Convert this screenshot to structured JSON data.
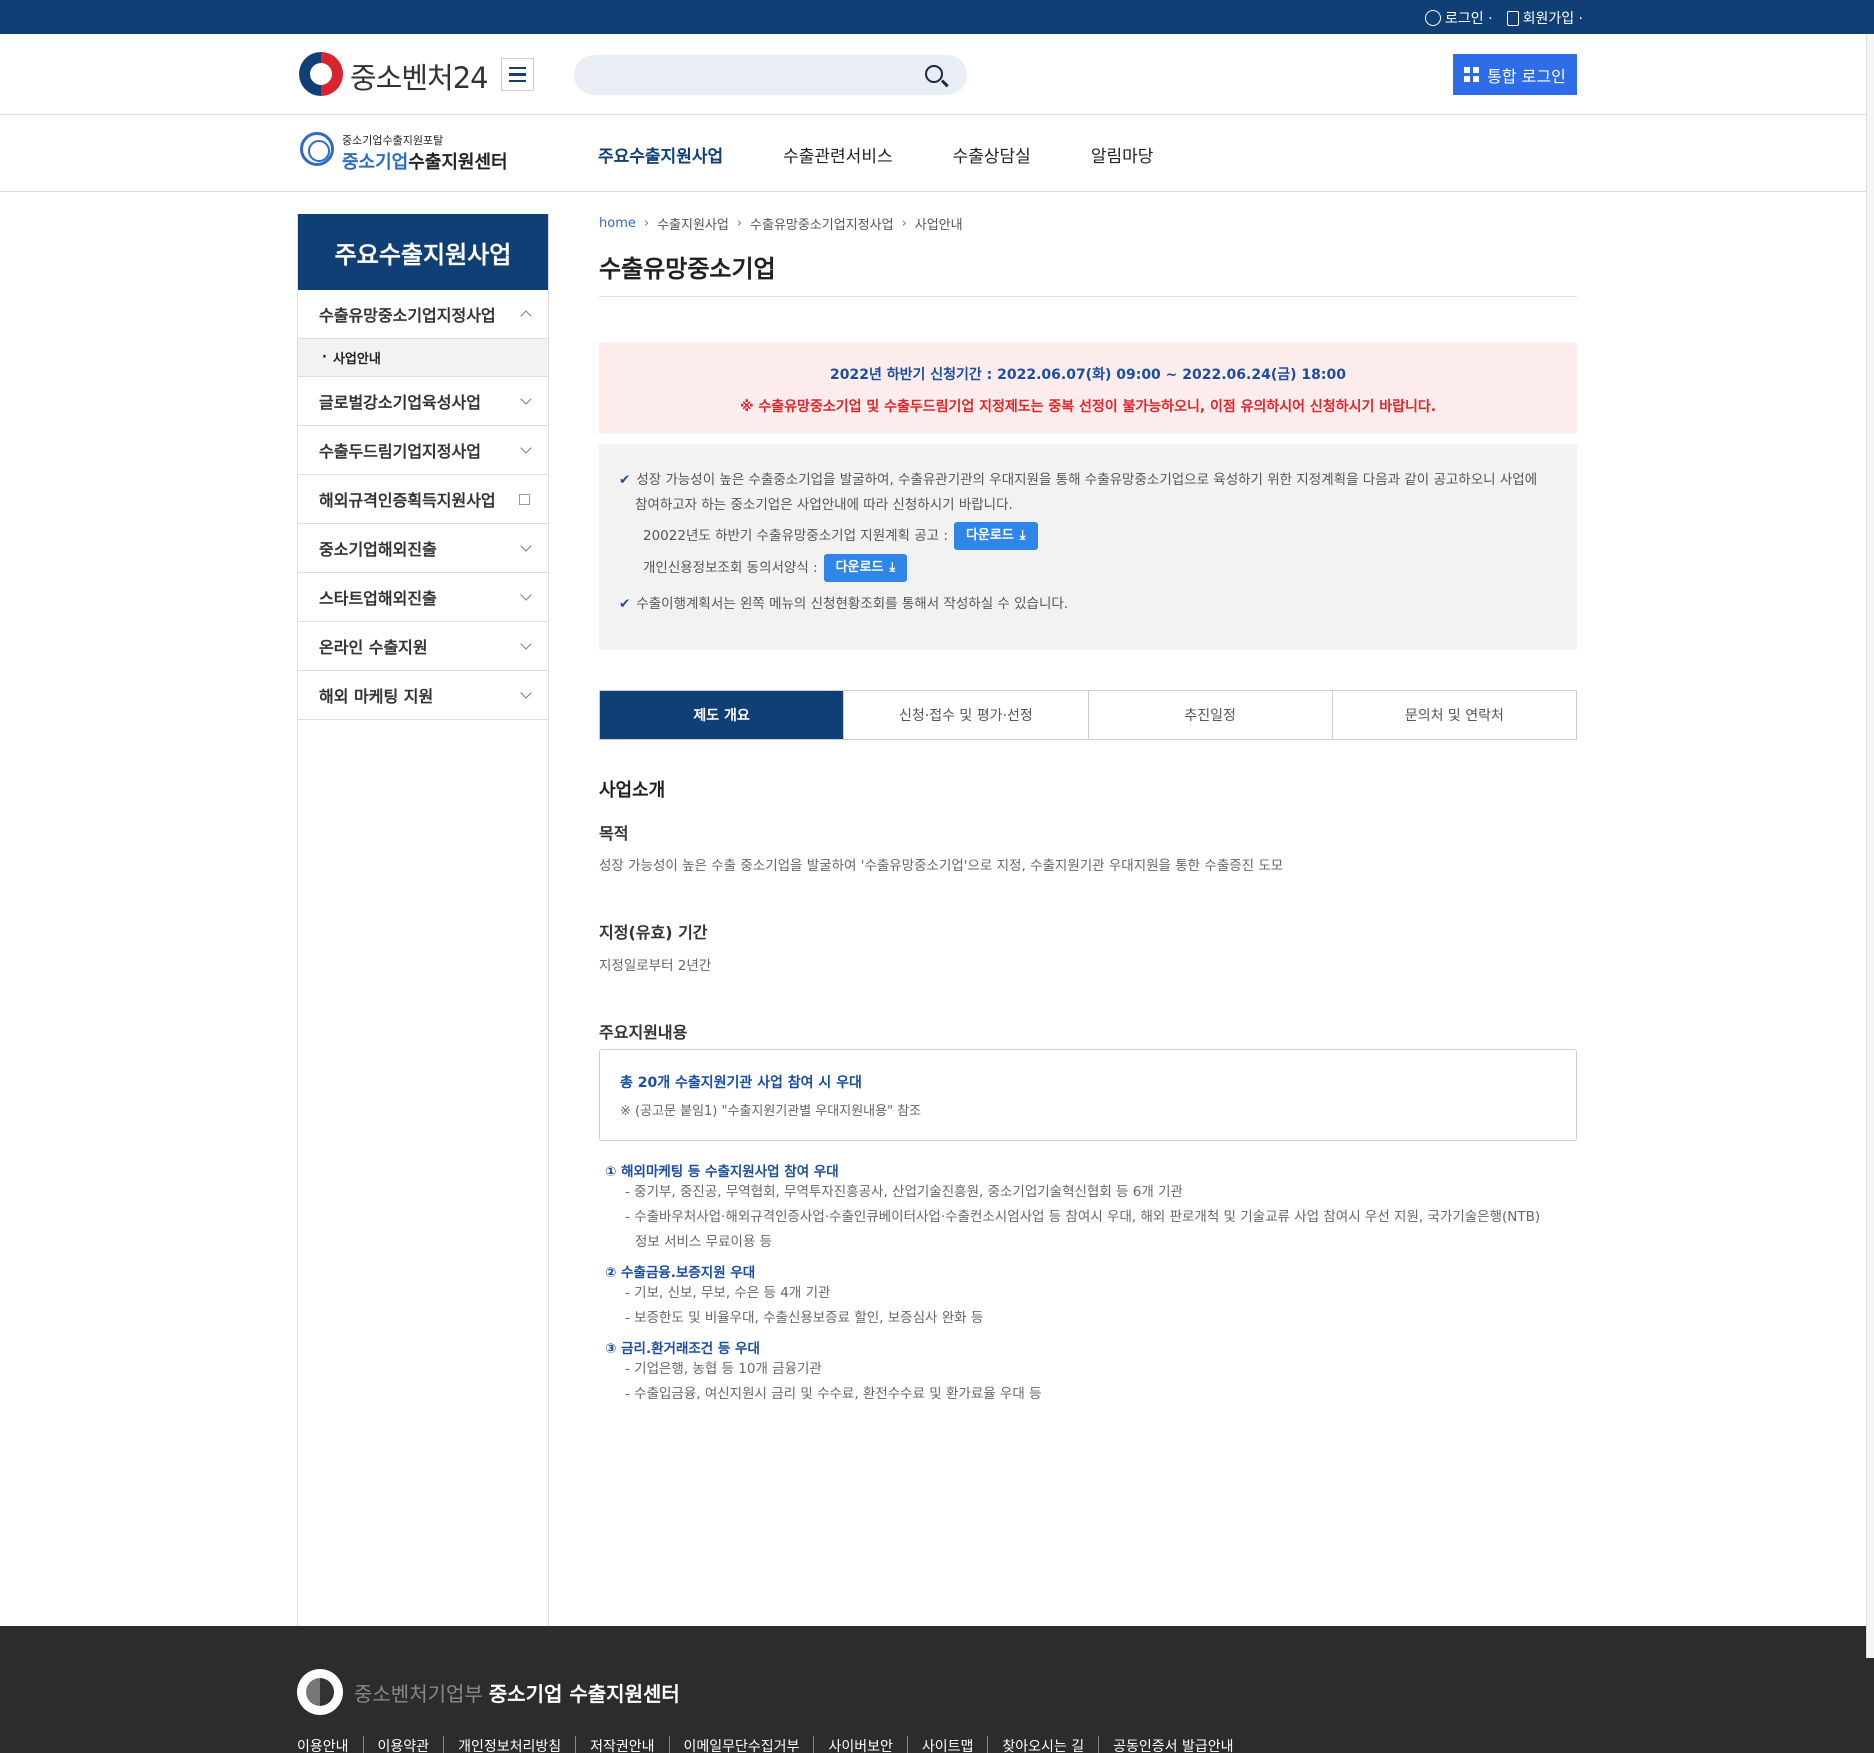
{
  "topbar": {
    "login": "로그인 ·",
    "signup": "회원가입 ·"
  },
  "header": {
    "logo": "중소벤처24",
    "search_placeholder": "",
    "login_button": "통합 로그인"
  },
  "gnb": {
    "logo_small": "중소기업수출지원포탈",
    "logo_big_prefix": "중소기업",
    "logo_big_suffix": "수출지원센터",
    "menu": [
      "주요수출지원사업",
      "수출관련서비스",
      "수출상담실",
      "알림마당"
    ]
  },
  "lnb": {
    "title": "주요수출지원사업",
    "items": [
      {
        "label": "수출유망중소기업지정사업",
        "icon": "chevron-up-icon"
      },
      {
        "label": "글로벌강소기업육성사업",
        "icon": "chevron-down-icon"
      },
      {
        "label": "수출두드림기업지정사업",
        "icon": "chevron-down-icon"
      },
      {
        "label": "해외규격인증획득지원사업",
        "icon": "external-link-icon"
      },
      {
        "label": "중소기업해외진출",
        "icon": "chevron-down-icon"
      },
      {
        "label": "스타트업해외진출",
        "icon": "chevron-down-icon"
      },
      {
        "label": "온라인 수출지원",
        "icon": "chevron-down-icon"
      },
      {
        "label": "해외 마케팅 지원",
        "icon": "chevron-down-icon"
      }
    ],
    "sub_item": "사업안내"
  },
  "breadcrumb": [
    "home",
    "수출지원사업",
    "수출유망중소기업지정사업",
    "사업안내"
  ],
  "page_title": "수출유망중소기업",
  "notice": {
    "line1": "2022년 하반기 신청기간 : 2022.06.07(화) 09:00 ~ 2022.06.24(금) 18:00",
    "line2": "※ 수출유망중소기업 및 수출두드림기업 지정제도는 중복 선정이 불가능하오니, 이점 유의하시어 신청하시기 바랍니다."
  },
  "info": {
    "line1": "성장 가능성이 높은 수출중소기업을 발굴하여, 수출유관기관의 우대지원을 통해 수출유망중소기업으로 육성하기 위한 지정계획을 다음과 같이 공고하오니 사업에",
    "line1b": "참여하고자 하는 중소기업은 사업안내에 따라 신청하시기 바랍니다.",
    "dl1_label": "20022년도 하반기 수출유망중소기업 지원계획 공고 :",
    "dl2_label": "개인신용정보조회 동의서양식 :",
    "download": "다운로드",
    "line2": "수출이행계획서는 왼쪽 메뉴의 신청현황조회를 통해서 작성하실 수 있습니다."
  },
  "tabs": [
    "제도 개요",
    "신청·접수 및 평가·선정",
    "추진일정",
    "문의처 및 연락처"
  ],
  "overview": {
    "section_title": "사업소개",
    "purpose_title": "목적",
    "purpose_text": "성장 가능성이 높은 수출 중소기업을 발굴하여 '수출유망중소기업'으로 지정, 수출지원기관 우대지원을 통한 수출증진 도모",
    "period_title": "지정(유효) 기간",
    "period_text": "지정일로부터 2년간",
    "support_title": "주요지원내용",
    "box_title": "총 20개 수출지원기관 사업 참여 시 우대",
    "box_note": "※ (공고문 붙임1) \"수출지원기관별 우대지원내용\" 참조",
    "item1_title": "① 해외마케팅 등 수출지원사업 참여 우대",
    "item1_l1": "- 중기부, 중진공, 무역협회, 무역투자진흥공사, 산업기술진흥원, 중소기업기술혁신협회 등 6개 기관",
    "item1_l2": "- 수출바우처사업·해외규격인증사업·수출인큐베이터사업·수출컨소시엄사업 등 참여시 우대, 해외 판로개척 및 기술교류 사업 참여시 우선 지원, 국가기술은행(NTB)",
    "item1_l3": "정보 서비스 무료이용 등",
    "item2_title": "② 수출금융.보증지원 우대",
    "item2_l1": "- 기보, 신보, 무보, 수은 등 4개 기관",
    "item2_l2": "- 보증한도 및 비율우대, 수출신용보증료 할인, 보증심사 완화 등",
    "item3_title": "③ 금리.환거래조건 등 우대",
    "item3_l1": "- 기업은행, 농협 등 10개 금융기관",
    "item3_l2": "- 수출입금융, 여신지원시 금리 및 수수료, 환전수수료 및 환가료율 우대 등"
  },
  "footer": {
    "ministry": "중소벤처기업부",
    "center": "중소기업 수출지원센터",
    "links": [
      "이용안내",
      "이용약관",
      "개인정보처리방침",
      "저작권안내",
      "이메일무단수집거부",
      "사이버보안",
      "사이트맵",
      "찾아오시는 길",
      "공동인증서 발급안내"
    ]
  },
  "colors": {
    "brand": "#0f3f75",
    "accent": "#2f6ce8",
    "notice_red": "#e0252b",
    "link_blue": "#1a4ea0"
  }
}
